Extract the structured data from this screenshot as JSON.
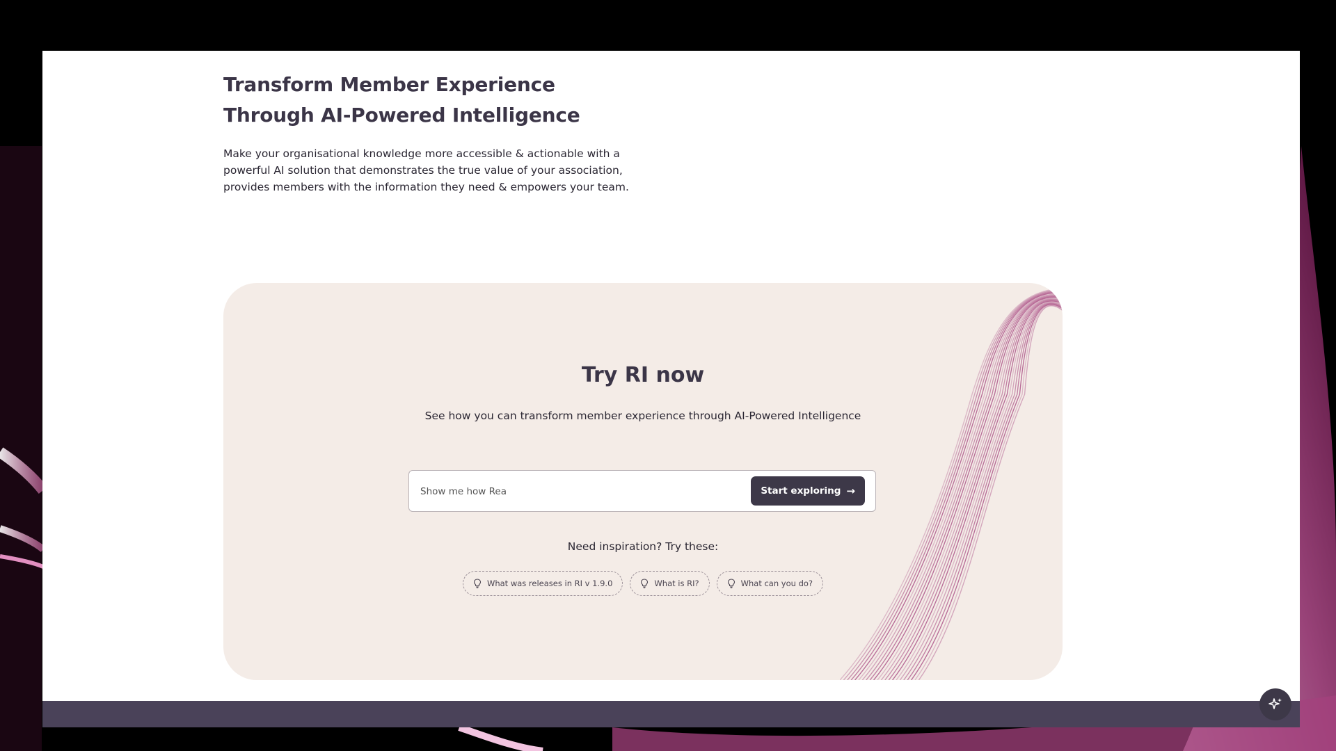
{
  "hero": {
    "title_line1": "Transform Member Experience",
    "title_line2": "Through AI-Powered Intelligence",
    "description": "Make your organisational knowledge more accessible & actionable with a powerful AI solution that demonstrates the true value of your association, provides members with the information they need & empowers your team."
  },
  "try_section": {
    "title": "Try RI now",
    "subtitle": "See how you can transform member experience through AI-Powered Intelligence",
    "search": {
      "value": "Show me how Rea",
      "button_label": "Start exploring",
      "button_icon": "arrow-right-icon"
    },
    "inspiration_label": "Need inspiration? Try these:",
    "suggestions": [
      {
        "label": "What was releases in RI v 1.9.0",
        "icon": "lightbulb-icon"
      },
      {
        "label": "What is RI?",
        "icon": "lightbulb-icon"
      },
      {
        "label": "What can you do?",
        "icon": "lightbulb-icon"
      }
    ]
  },
  "assistant_button": {
    "icon": "sparkle-icon"
  },
  "colors": {
    "brand_dark": "#3d3848",
    "card_background": "#f4ece7",
    "wave_accent": "#a4417d",
    "footer": "#4a4259"
  }
}
